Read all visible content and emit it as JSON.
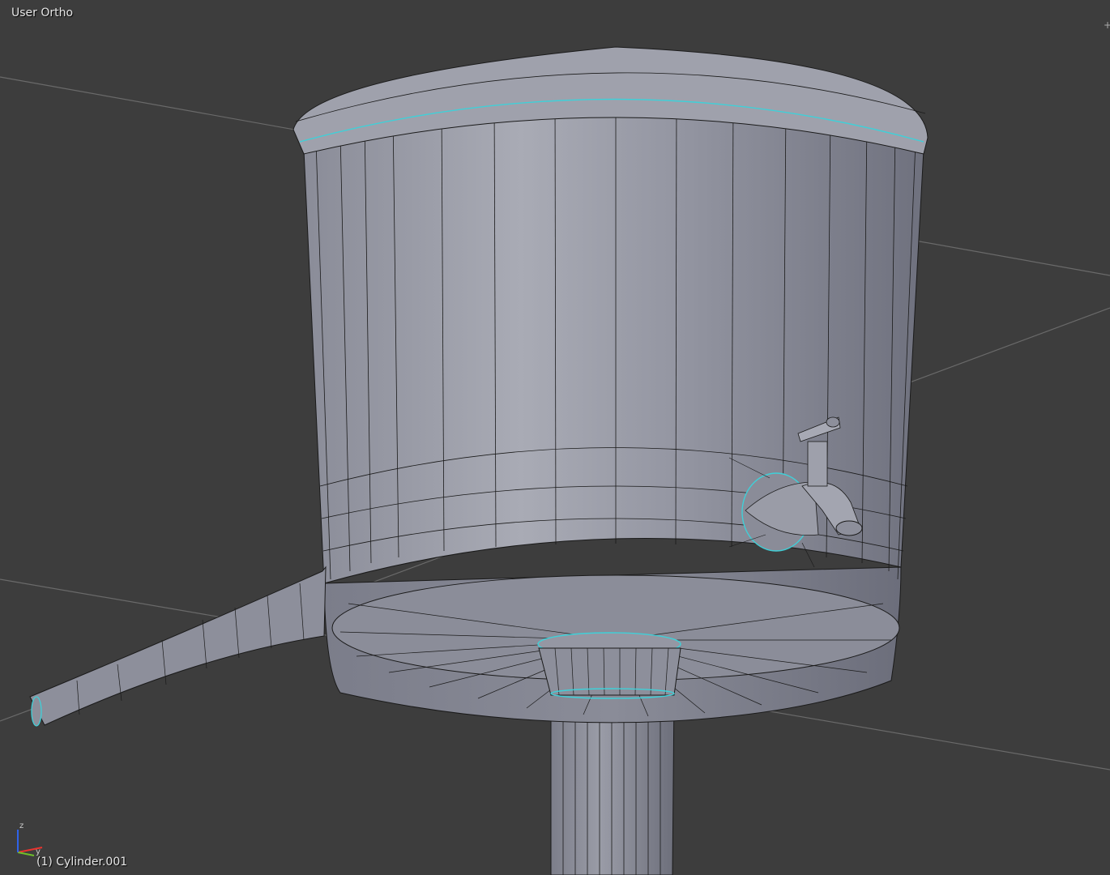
{
  "viewport": {
    "view_label": "User Ortho",
    "object_label": "(1) Cylinder.001",
    "corner_widget_icon": "+",
    "background_color": "#3d3d3d",
    "mesh_color": "#8e909c",
    "wire_color": "#1a1a1a",
    "seam_color": "#3fd0d8"
  },
  "axis_gizmo": {
    "z_label": "z",
    "y_label": "y",
    "colors": {
      "x": "#e8342f",
      "y": "#6fbf2a",
      "z": "#2f63e8"
    }
  }
}
